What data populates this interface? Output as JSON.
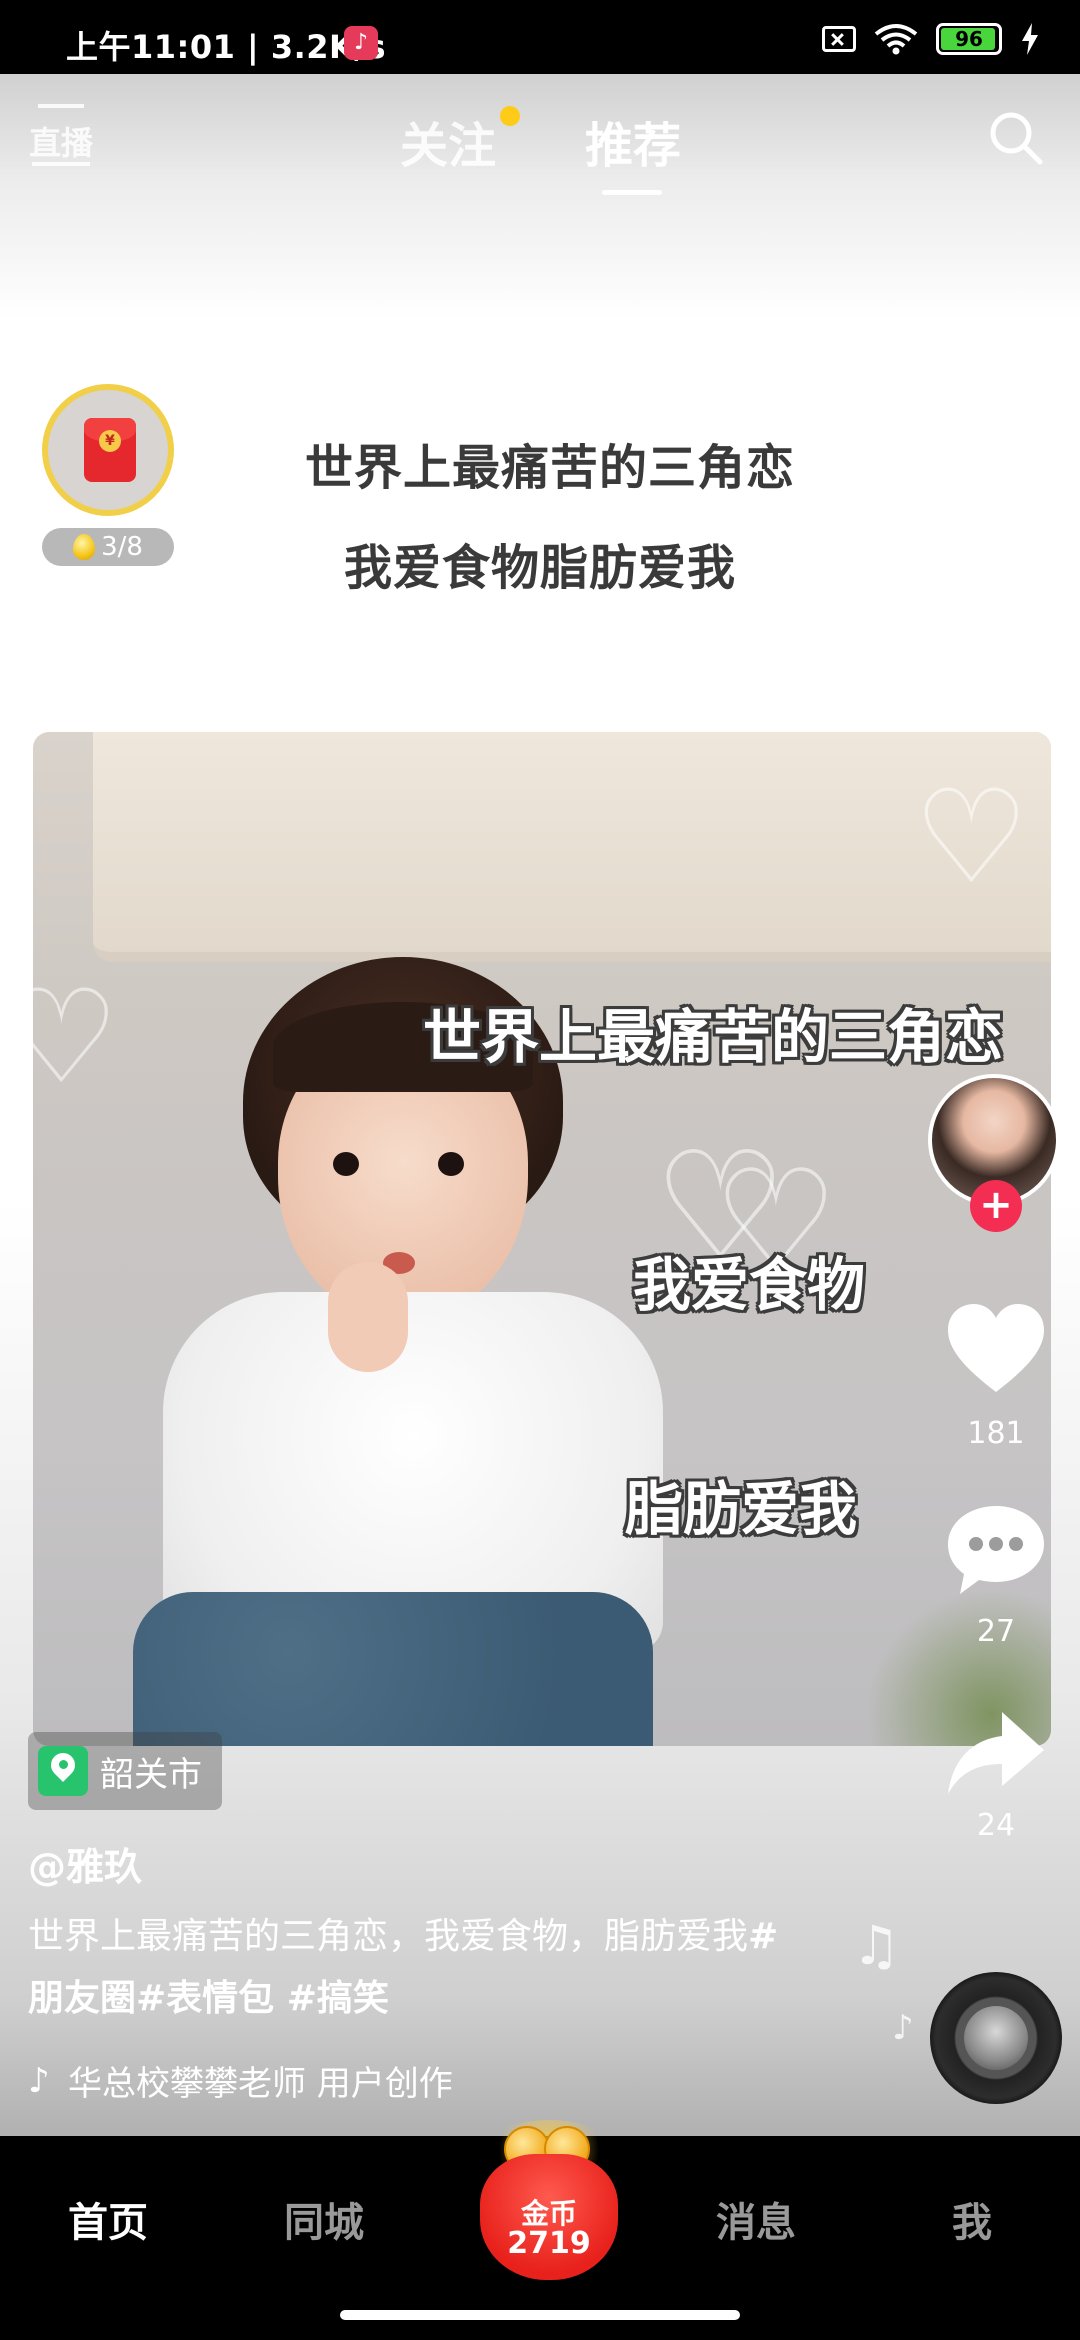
{
  "status_bar": {
    "time": "上午11:01 | 3.2K/s",
    "battery": "96",
    "battery_level": 0.96
  },
  "header": {
    "live_label": "直播",
    "tabs": [
      {
        "label": "关注",
        "has_dot": true
      },
      {
        "label": "推荐",
        "active": true
      }
    ]
  },
  "task_widget": {
    "progress": "3/8"
  },
  "caption": {
    "line1": "世界上最痛苦的三角恋",
    "line2": "我爱食物脂肪爱我"
  },
  "photo_overlay": {
    "line1": "世界上最痛苦的三角恋",
    "line2": "我爱食物",
    "line3": "脂肪爱我"
  },
  "location": "韶关市",
  "rail": {
    "likes": "181",
    "comments": "27",
    "shares": "24"
  },
  "author": "@雅玖",
  "description": {
    "text": "世界上最痛苦的三角恋，我爱食物，脂肪爱我",
    "tags": "#朋友圈#表情包 #搞笑"
  },
  "music": "华总校攀攀老师    用户创作",
  "bottom_nav": {
    "home": "首页",
    "city": "同城",
    "coin_label": "金币",
    "coin_count": "2719",
    "messages": "消息",
    "me": "我"
  },
  "colors": {
    "accent_red": "#f42d52",
    "status_battery": "#49d63c",
    "follow_dot": "#ffcb19",
    "location_green": "#27c46d"
  }
}
